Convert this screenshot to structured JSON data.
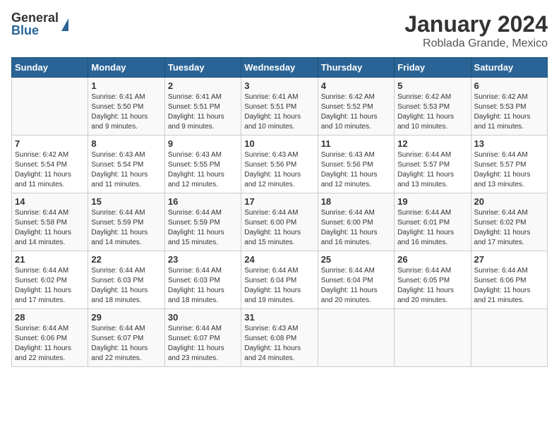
{
  "logo": {
    "general": "General",
    "blue": "Blue"
  },
  "title": "January 2024",
  "subtitle": "Roblada Grande, Mexico",
  "days": [
    "Sunday",
    "Monday",
    "Tuesday",
    "Wednesday",
    "Thursday",
    "Friday",
    "Saturday"
  ],
  "weeks": [
    [
      {
        "date": "",
        "info": ""
      },
      {
        "date": "1",
        "info": "Sunrise: 6:41 AM\nSunset: 5:50 PM\nDaylight: 11 hours\nand 9 minutes."
      },
      {
        "date": "2",
        "info": "Sunrise: 6:41 AM\nSunset: 5:51 PM\nDaylight: 11 hours\nand 9 minutes."
      },
      {
        "date": "3",
        "info": "Sunrise: 6:41 AM\nSunset: 5:51 PM\nDaylight: 11 hours\nand 10 minutes."
      },
      {
        "date": "4",
        "info": "Sunrise: 6:42 AM\nSunset: 5:52 PM\nDaylight: 11 hours\nand 10 minutes."
      },
      {
        "date": "5",
        "info": "Sunrise: 6:42 AM\nSunset: 5:53 PM\nDaylight: 11 hours\nand 10 minutes."
      },
      {
        "date": "6",
        "info": "Sunrise: 6:42 AM\nSunset: 5:53 PM\nDaylight: 11 hours\nand 11 minutes."
      }
    ],
    [
      {
        "date": "7",
        "info": "Sunrise: 6:42 AM\nSunset: 5:54 PM\nDaylight: 11 hours\nand 11 minutes."
      },
      {
        "date": "8",
        "info": "Sunrise: 6:43 AM\nSunset: 5:54 PM\nDaylight: 11 hours\nand 11 minutes."
      },
      {
        "date": "9",
        "info": "Sunrise: 6:43 AM\nSunset: 5:55 PM\nDaylight: 11 hours\nand 12 minutes."
      },
      {
        "date": "10",
        "info": "Sunrise: 6:43 AM\nSunset: 5:56 PM\nDaylight: 11 hours\nand 12 minutes."
      },
      {
        "date": "11",
        "info": "Sunrise: 6:43 AM\nSunset: 5:56 PM\nDaylight: 11 hours\nand 12 minutes."
      },
      {
        "date": "12",
        "info": "Sunrise: 6:44 AM\nSunset: 5:57 PM\nDaylight: 11 hours\nand 13 minutes."
      },
      {
        "date": "13",
        "info": "Sunrise: 6:44 AM\nSunset: 5:57 PM\nDaylight: 11 hours\nand 13 minutes."
      }
    ],
    [
      {
        "date": "14",
        "info": "Sunrise: 6:44 AM\nSunset: 5:58 PM\nDaylight: 11 hours\nand 14 minutes."
      },
      {
        "date": "15",
        "info": "Sunrise: 6:44 AM\nSunset: 5:59 PM\nDaylight: 11 hours\nand 14 minutes."
      },
      {
        "date": "16",
        "info": "Sunrise: 6:44 AM\nSunset: 5:59 PM\nDaylight: 11 hours\nand 15 minutes."
      },
      {
        "date": "17",
        "info": "Sunrise: 6:44 AM\nSunset: 6:00 PM\nDaylight: 11 hours\nand 15 minutes."
      },
      {
        "date": "18",
        "info": "Sunrise: 6:44 AM\nSunset: 6:00 PM\nDaylight: 11 hours\nand 16 minutes."
      },
      {
        "date": "19",
        "info": "Sunrise: 6:44 AM\nSunset: 6:01 PM\nDaylight: 11 hours\nand 16 minutes."
      },
      {
        "date": "20",
        "info": "Sunrise: 6:44 AM\nSunset: 6:02 PM\nDaylight: 11 hours\nand 17 minutes."
      }
    ],
    [
      {
        "date": "21",
        "info": "Sunrise: 6:44 AM\nSunset: 6:02 PM\nDaylight: 11 hours\nand 17 minutes."
      },
      {
        "date": "22",
        "info": "Sunrise: 6:44 AM\nSunset: 6:03 PM\nDaylight: 11 hours\nand 18 minutes."
      },
      {
        "date": "23",
        "info": "Sunrise: 6:44 AM\nSunset: 6:03 PM\nDaylight: 11 hours\nand 18 minutes."
      },
      {
        "date": "24",
        "info": "Sunrise: 6:44 AM\nSunset: 6:04 PM\nDaylight: 11 hours\nand 19 minutes."
      },
      {
        "date": "25",
        "info": "Sunrise: 6:44 AM\nSunset: 6:04 PM\nDaylight: 11 hours\nand 20 minutes."
      },
      {
        "date": "26",
        "info": "Sunrise: 6:44 AM\nSunset: 6:05 PM\nDaylight: 11 hours\nand 20 minutes."
      },
      {
        "date": "27",
        "info": "Sunrise: 6:44 AM\nSunset: 6:06 PM\nDaylight: 11 hours\nand 21 minutes."
      }
    ],
    [
      {
        "date": "28",
        "info": "Sunrise: 6:44 AM\nSunset: 6:06 PM\nDaylight: 11 hours\nand 22 minutes."
      },
      {
        "date": "29",
        "info": "Sunrise: 6:44 AM\nSunset: 6:07 PM\nDaylight: 11 hours\nand 22 minutes."
      },
      {
        "date": "30",
        "info": "Sunrise: 6:44 AM\nSunset: 6:07 PM\nDaylight: 11 hours\nand 23 minutes."
      },
      {
        "date": "31",
        "info": "Sunrise: 6:43 AM\nSunset: 6:08 PM\nDaylight: 11 hours\nand 24 minutes."
      },
      {
        "date": "",
        "info": ""
      },
      {
        "date": "",
        "info": ""
      },
      {
        "date": "",
        "info": ""
      }
    ]
  ]
}
